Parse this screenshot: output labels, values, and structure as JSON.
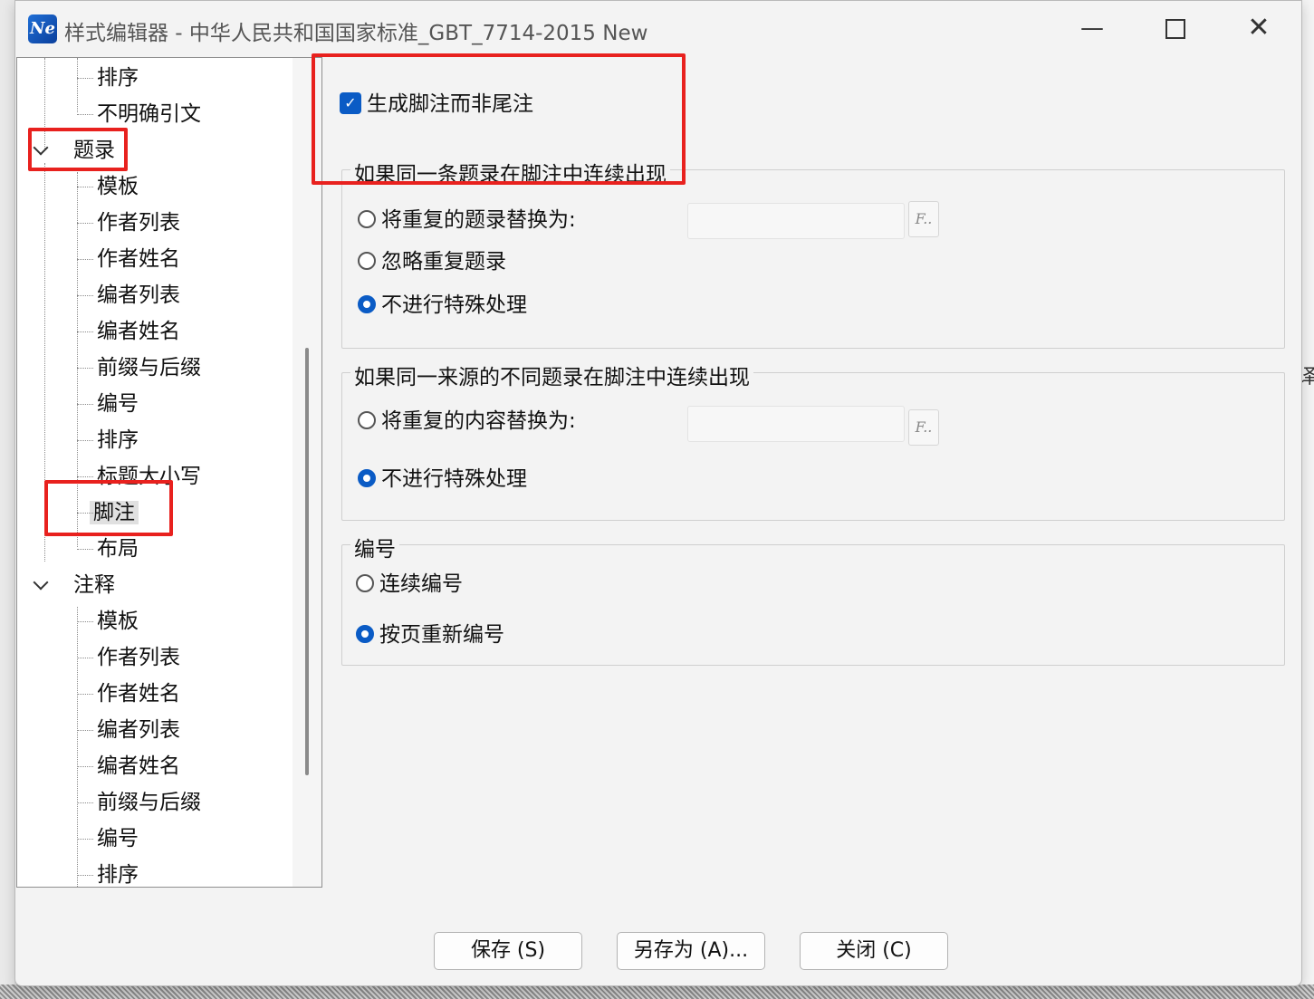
{
  "window": {
    "title": "样式编辑器 - 中华人民共和国国家标准_GBT_7714-2015 New",
    "app_icon": "Ne",
    "min_symbol": "—",
    "close_symbol": "✕"
  },
  "tree": {
    "items": [
      {
        "label": "排序"
      },
      {
        "label": "不明确引文"
      },
      {
        "label": "题录"
      },
      {
        "label": "模板"
      },
      {
        "label": "作者列表"
      },
      {
        "label": "作者姓名"
      },
      {
        "label": "编者列表"
      },
      {
        "label": "编者姓名"
      },
      {
        "label": "前缀与后缀"
      },
      {
        "label": "编号"
      },
      {
        "label": "排序"
      },
      {
        "label": "标题大小写"
      },
      {
        "label": "脚注"
      },
      {
        "label": "布局"
      },
      {
        "label": "注释"
      },
      {
        "label": "模板"
      },
      {
        "label": "作者列表"
      },
      {
        "label": "作者姓名"
      },
      {
        "label": "编者列表"
      },
      {
        "label": "编者姓名"
      },
      {
        "label": "前缀与后缀"
      },
      {
        "label": "编号"
      },
      {
        "label": "排序"
      }
    ]
  },
  "content": {
    "footnote_checkbox": "生成脚注而非尾注",
    "group1": {
      "legend": "如果同一条题录在脚注中连续出现",
      "opt_replace": "将重复的题录替换为:",
      "opt_ignore": "忽略重复题录",
      "opt_none": "不进行特殊处理",
      "fx_label": "F.."
    },
    "group2": {
      "legend": "如果同一来源的不同题录在脚注中连续出现",
      "opt_replace": "将重复的内容替换为:",
      "opt_none": "不进行特殊处理",
      "fx_label": "F.."
    },
    "group3": {
      "legend": "编号",
      "opt_continuous": "连续编号",
      "opt_per_page": "按页重新编号"
    }
  },
  "buttons": {
    "save": "保存 (S)",
    "save_as": "另存为 (A)...",
    "close": "关闭 (C)"
  },
  "background": {
    "right_glyph": "译"
  },
  "colors": {
    "accent": "#0a5bc5",
    "highlight": "#e8211e"
  }
}
